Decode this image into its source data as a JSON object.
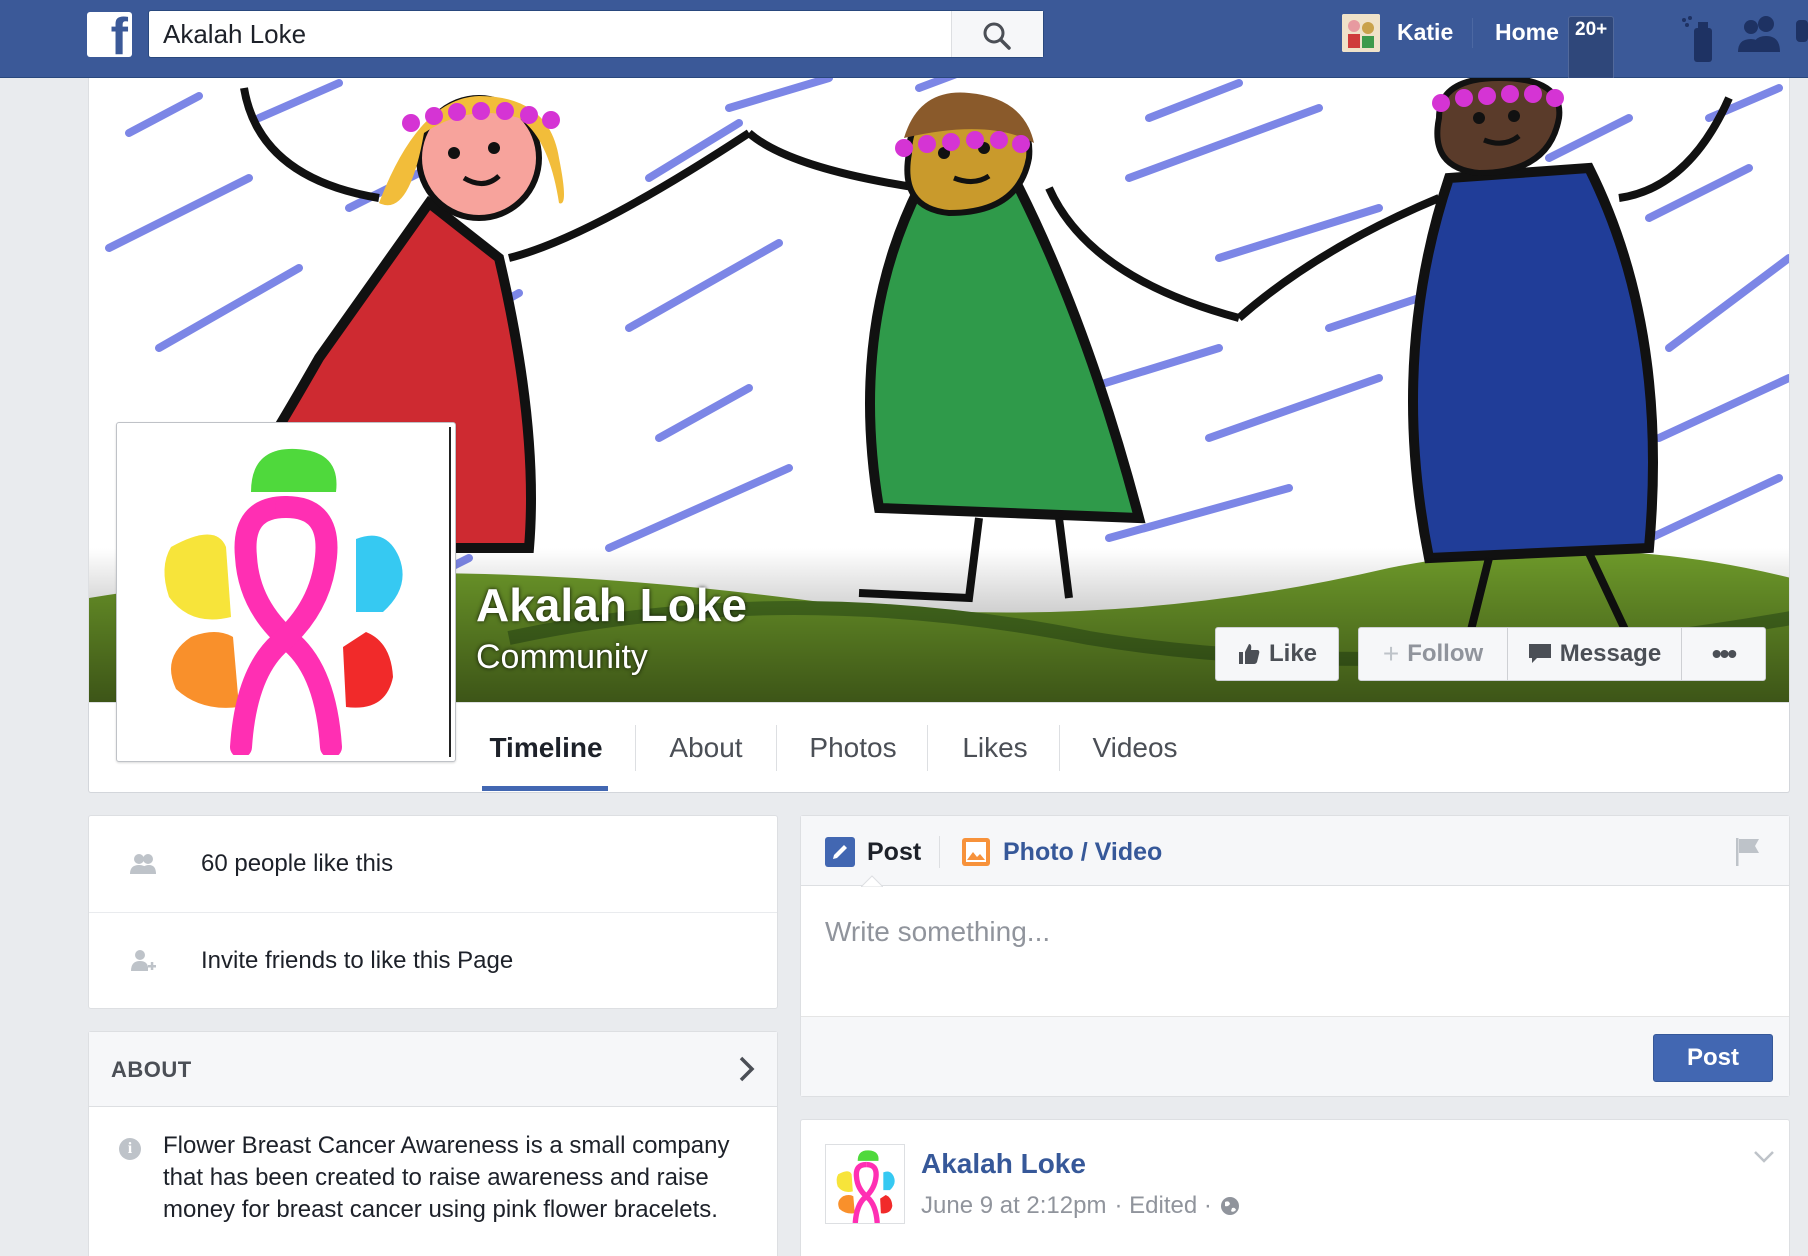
{
  "topbar": {
    "logo_letter": "f",
    "search_value": "Akalah Loke",
    "user_name": "Katie",
    "home_label": "Home",
    "home_badge": "20+"
  },
  "page": {
    "name": "Akalah Loke",
    "category": "Community"
  },
  "actions": {
    "like": "Like",
    "follow": "Follow",
    "message": "Message",
    "more": "•••"
  },
  "tabs": [
    {
      "label": "Timeline"
    },
    {
      "label": "About"
    },
    {
      "label": "Photos"
    },
    {
      "label": "Likes"
    },
    {
      "label": "Videos"
    }
  ],
  "sidebar": {
    "likes_count_text": "60 people like this",
    "invite_text": "Invite friends to like this Page",
    "about_title": "ABOUT",
    "about_text": "Flower Breast Cancer Awareness is a small company that has been created to raise awareness and raise money for breast cancer using pink flower bracelets."
  },
  "composer": {
    "tab_post": "Post",
    "tab_photo": "Photo / Video",
    "placeholder": "Write something...",
    "submit": "Post"
  },
  "story": {
    "author": "Akalah Loke",
    "date": "June 9 at 2:12pm",
    "edited": "· Edited ·"
  },
  "colors": {
    "brand_blue": "#3b5998",
    "link_blue": "#365899",
    "button_blue": "#4267b2",
    "ribbon_pink": "#ff2fb3"
  },
  "icons": {
    "search": "magnifier",
    "likes": "people-icon",
    "invite": "add-person-icon",
    "about_info": "info-icon",
    "flag": "flag-icon",
    "globe": "globe-icon"
  }
}
